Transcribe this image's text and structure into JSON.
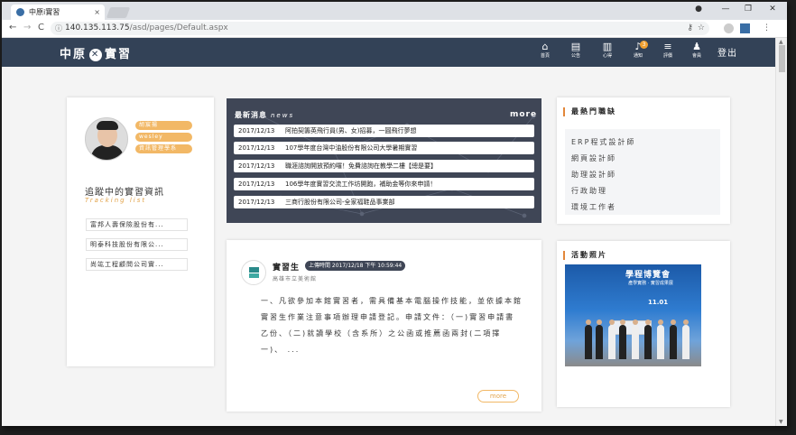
{
  "browser": {
    "tab_title": "中原i實習",
    "tab_close": "×",
    "url_host": "140.135.113.75",
    "url_path": "/asd/pages/Default.aspx",
    "lock_icon": "ⓘ",
    "back": "←",
    "forward": "→",
    "reload": "C",
    "key_icon": "⚷",
    "star_icon": "☆",
    "menu_icon": "⋮",
    "win_min": "—",
    "win_max": "❐",
    "win_close": "✕",
    "account_icon": "●"
  },
  "header": {
    "logo_left": "中原",
    "logo_mark": "✕",
    "logo_right": "實習",
    "logout": "登出",
    "nav": [
      {
        "icon": "⌂",
        "label": "首頁"
      },
      {
        "icon": "▤",
        "label": "公告"
      },
      {
        "icon": "▥",
        "label": "心得"
      },
      {
        "icon": "♪",
        "label": "通知",
        "badge": "3"
      },
      {
        "icon": "≡",
        "label": "評價"
      },
      {
        "icon": "♟",
        "label": "會員"
      }
    ]
  },
  "profile": {
    "name": "胡宸揚",
    "account": "wesley",
    "department": "資訊管理學系",
    "tracking_title": "追蹤中的實習資訊",
    "tracking_sub": "Tracking list",
    "companies": [
      "富邦人壽保險股份有...",
      "明泰科技股份有限公...",
      "尚竑工程顧問公司實..."
    ]
  },
  "news": {
    "title": "最新消息",
    "title_en": "news",
    "more": "more",
    "items": [
      {
        "date": "2017/12/13",
        "text": "阿拍契籌英飛行員(男、女)招募，一圓飛行夢想"
      },
      {
        "date": "2017/12/13",
        "text": "107學年度台灣中油股份有限公司大學暑期實習"
      },
      {
        "date": "2017/12/13",
        "text": "職涯諮詢開放預約囉！免費諮詢在教學二樓【總是要】"
      },
      {
        "date": "2017/12/13",
        "text": "106學年度實習交流工作坊開跑，補助金等你來申請！"
      },
      {
        "date": "2017/12/13",
        "text": "三商行股份有限公司-全家福鞋品事業部"
      }
    ]
  },
  "hot_jobs": {
    "title": "最熱門職缺",
    "items": [
      "ERP程式設計師",
      "網頁設計師",
      "助理設計師",
      "行政助理",
      "環境工作者"
    ]
  },
  "post": {
    "author": "實習生",
    "time_label": "上傳時間 2017/12/18 下午 10:59:44",
    "school": "高雄市立美術館",
    "body": "一、凡欲參加本館實習者，需具備基本電腦操作技能，並依據本館實習生作業注意事項辦理申請登記。申請文件：（一)實習申請書乙份、（二)就讀學校（含系所）之公函或推薦函兩封(二項擇一)、 ...",
    "more": "more"
  },
  "photos": {
    "title": "活動照片",
    "banner": "學程博覽會",
    "banner_sub": "產學實務 · 實習成果展",
    "banner_date": "11.01"
  },
  "colors": {
    "header_bg": "#334257",
    "accent": "#f2b866",
    "news_bg": "#3f4656"
  }
}
